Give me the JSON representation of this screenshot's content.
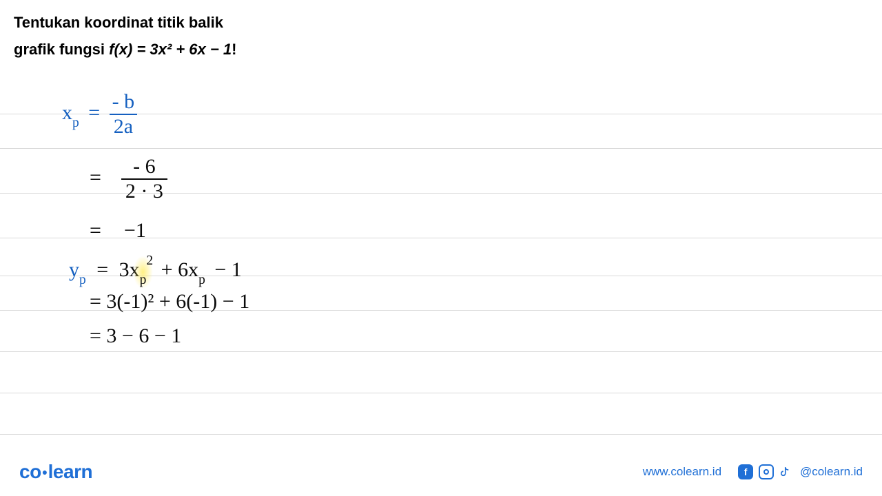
{
  "question": {
    "line1": "Tentukan koordinat titik balik",
    "line2_prefix": "grafik fungsi ",
    "line2_fx": "f(x) = 3x² + 6x − 1",
    "line2_suffix": "!"
  },
  "work": {
    "xp_label": "x",
    "xp_sub": "p",
    "eq": "=",
    "frac1_num": "- b",
    "frac1_den": "2a",
    "frac2_num": "- 6",
    "frac2_den": "2 · 3",
    "xp_result": "−1",
    "yp_label": "y",
    "yp_sub": "p",
    "yp_expr_a": "3x",
    "yp_expr_sub": "p",
    "yp_expr_sup": "2",
    "yp_expr_b": "+ 6x",
    "yp_expr_c": "− 1",
    "yp_line2": "= 3(-1)² + 6(-1) − 1",
    "yp_line3": "= 3 − 6 − 1"
  },
  "footer": {
    "logo_co": "co",
    "logo_learn": "learn",
    "url": "www.colearn.id",
    "handle": "@colearn.id"
  }
}
